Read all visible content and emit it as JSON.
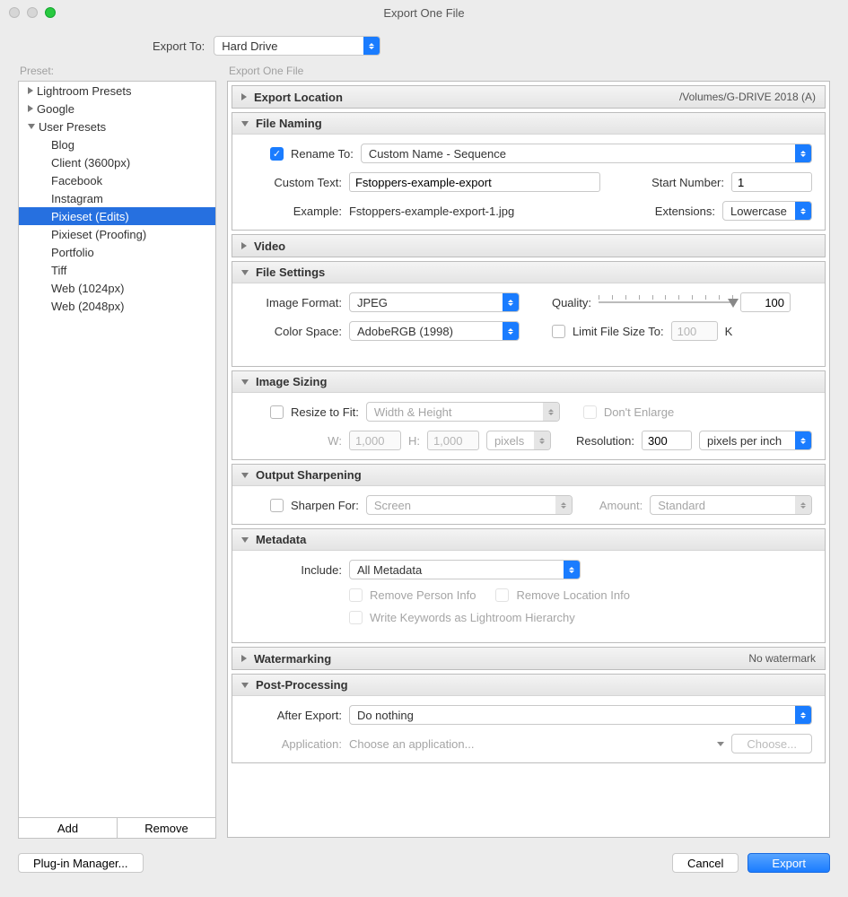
{
  "window": {
    "title": "Export One File"
  },
  "exportTo": {
    "label": "Export To:",
    "value": "Hard Drive"
  },
  "preset": {
    "label": "Preset:",
    "groups": [
      {
        "label": "Lightroom Presets",
        "expanded": false
      },
      {
        "label": "Google",
        "expanded": false
      },
      {
        "label": "User Presets",
        "expanded": true
      }
    ],
    "userItems": [
      "Blog",
      "Client (3600px)",
      "Facebook",
      "Instagram",
      "Pixieset (Edits)",
      "Pixieset (Proofing)",
      "Portfolio",
      "Tiff",
      "Web (1024px)",
      "Web (2048px)"
    ],
    "selected": "Pixieset (Edits)",
    "addLabel": "Add",
    "removeLabel": "Remove"
  },
  "rightTitle": "Export One File",
  "panels": {
    "exportLocation": {
      "title": "Export Location",
      "summary": "/Volumes/G-DRIVE 2018 (A)"
    },
    "fileNaming": {
      "title": "File Naming",
      "renameTo": "Rename To:",
      "renameSelect": "Custom Name - Sequence",
      "customTextLabel": "Custom Text:",
      "customText": "Fstoppers-example-export",
      "startNumberLabel": "Start Number:",
      "startNumber": "1",
      "exampleLabel": "Example:",
      "example": "Fstoppers-example-export-1.jpg",
      "extensionsLabel": "Extensions:",
      "extensions": "Lowercase"
    },
    "video": {
      "title": "Video"
    },
    "fileSettings": {
      "title": "File Settings",
      "imageFormatLabel": "Image Format:",
      "imageFormat": "JPEG",
      "qualityLabel": "Quality:",
      "quality": "100",
      "colorSpaceLabel": "Color Space:",
      "colorSpace": "AdobeRGB (1998)",
      "limitLabel": "Limit File Size To:",
      "limitValue": "100",
      "limitUnit": "K"
    },
    "imageSizing": {
      "title": "Image Sizing",
      "resizeLabel": "Resize to Fit:",
      "resizeMode": "Width & Height",
      "dontEnlarge": "Don't Enlarge",
      "wLabel": "W:",
      "wValue": "1,000",
      "hLabel": "H:",
      "hValue": "1,000",
      "unit": "pixels",
      "resolutionLabel": "Resolution:",
      "resolution": "300",
      "resolutionUnit": "pixels per inch"
    },
    "outputSharpening": {
      "title": "Output Sharpening",
      "sharpenLabel": "Sharpen For:",
      "sharpenValue": "Screen",
      "amountLabel": "Amount:",
      "amountValue": "Standard"
    },
    "metadata": {
      "title": "Metadata",
      "includeLabel": "Include:",
      "includeValue": "All Metadata",
      "removePerson": "Remove Person Info",
      "removeLocation": "Remove Location Info",
      "writeKeywords": "Write Keywords as Lightroom Hierarchy"
    },
    "watermarking": {
      "title": "Watermarking",
      "summary": "No watermark"
    },
    "postProcessing": {
      "title": "Post-Processing",
      "afterLabel": "After Export:",
      "afterValue": "Do nothing",
      "appLabel": "Application:",
      "appValue": "Choose an application...",
      "chooseBtn": "Choose..."
    }
  },
  "footer": {
    "plugin": "Plug-in Manager...",
    "cancel": "Cancel",
    "export": "Export"
  }
}
